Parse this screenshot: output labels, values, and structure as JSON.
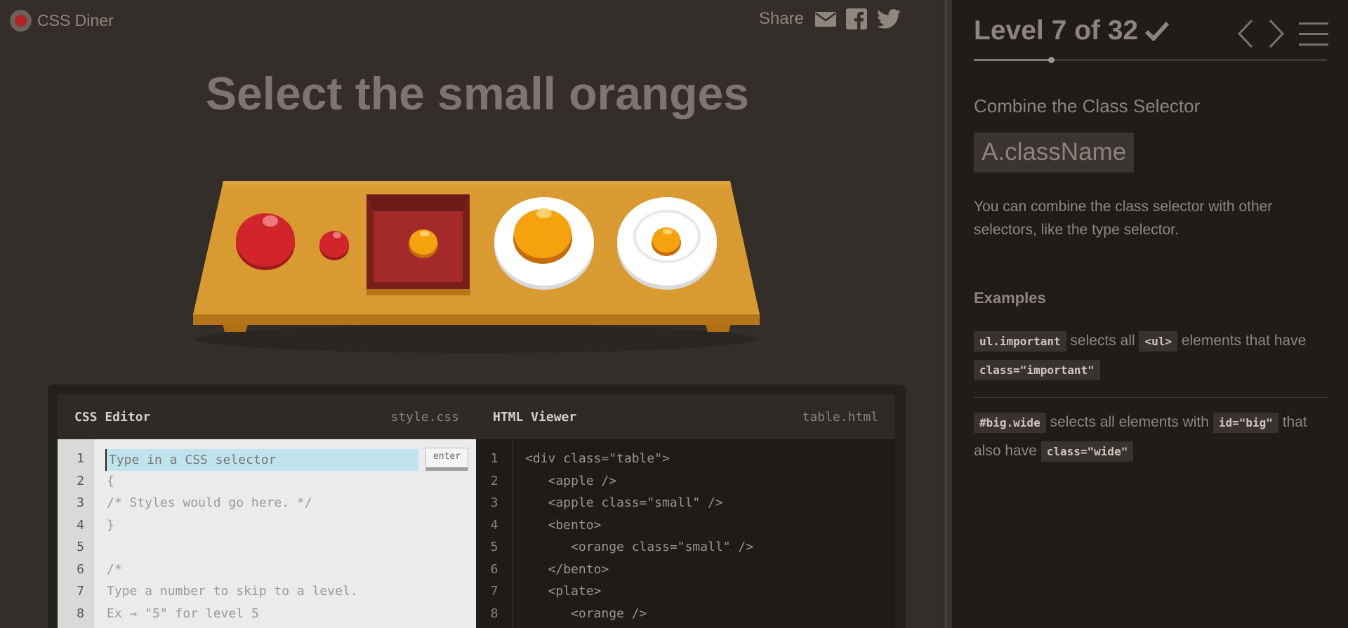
{
  "header": {
    "logo_text": "CSS Diner",
    "share_label": "Share",
    "share_icons": [
      "mail-icon",
      "facebook-icon",
      "twitter-icon"
    ]
  },
  "order": "Select the small oranges",
  "table_items": [
    {
      "type": "apple",
      "size": "large"
    },
    {
      "type": "apple",
      "class": "small"
    },
    {
      "type": "bento",
      "contains": {
        "type": "orange",
        "class": "small"
      }
    },
    {
      "type": "plate",
      "contains": {
        "type": "orange"
      }
    },
    {
      "type": "plate",
      "contains": {
        "type": "orange",
        "class": "small"
      }
    }
  ],
  "editor": {
    "css_title": "CSS Editor",
    "css_file": "style.css",
    "html_title": "HTML Viewer",
    "html_file": "table.html",
    "css_placeholder": "Type in a CSS selector",
    "css_input_value": "",
    "enter_label": "enter",
    "css_line_numbers": [
      "1",
      "2",
      "3",
      "4",
      "5",
      "6",
      "7",
      "8"
    ],
    "css_lines": [
      "",
      "{",
      "/* Styles would go here. */",
      "}",
      "",
      "/*",
      "Type a number to skip to a level.",
      "Ex → \"5\" for level 5"
    ],
    "html_line_numbers": [
      "1",
      "2",
      "3",
      "4",
      "5",
      "6",
      "7",
      "8"
    ],
    "html_lines": [
      "<div class=\"table\">",
      "   <apple />",
      "   <apple class=\"small\" />",
      "   <bento>",
      "      <orange class=\"small\" />",
      "   </bento>",
      "   <plate>",
      "      <orange />"
    ]
  },
  "sidebar": {
    "level_text": "Level 7 of 32",
    "level_completed_icon": "check-icon",
    "level_current": 7,
    "level_total": 32,
    "nav_icons": [
      "chevron-left-icon",
      "chevron-right-icon",
      "menu-icon"
    ],
    "selector_name": "Combine the Class Selector",
    "syntax": "A.className",
    "hint": "You can combine the class selector with other selectors, like the type selector.",
    "examples_title": "Examples",
    "examples": [
      {
        "parts": [
          "ul.important",
          " selects all ",
          "<ul>",
          " elements that have ",
          "class=\"important\""
        ]
      },
      {
        "parts": [
          "#big.wide",
          " selects all elements with ",
          "id=\"big\"",
          " that also have ",
          "class=\"wide\""
        ]
      }
    ]
  },
  "colors": {
    "background": "#332e29",
    "table": "#d7962e",
    "apple": "#c81f25",
    "orange": "#f29a0c",
    "bento": "#8a2a28",
    "plate": "#ffffff",
    "css_input_highlight": "#c1e3ee"
  }
}
